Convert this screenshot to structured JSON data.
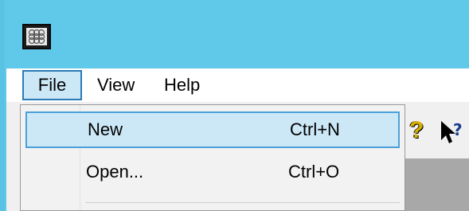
{
  "window": {
    "app_icon": "app-grid-icon"
  },
  "menubar": {
    "items": [
      {
        "label": "File"
      },
      {
        "label": "View"
      },
      {
        "label": "Help"
      }
    ]
  },
  "file_menu": {
    "items": [
      {
        "label": "New",
        "shortcut": "Ctrl+N",
        "highlighted": true
      },
      {
        "label": "Open...",
        "shortcut": "Ctrl+O",
        "highlighted": false
      }
    ]
  },
  "toolbar": {
    "icons": [
      "question-icon",
      "help-pointer-icon"
    ]
  },
  "colors": {
    "title_bar": "#60c8e8",
    "menu_highlight": "#cce8f7",
    "highlight_border": "#4aa0d8"
  }
}
